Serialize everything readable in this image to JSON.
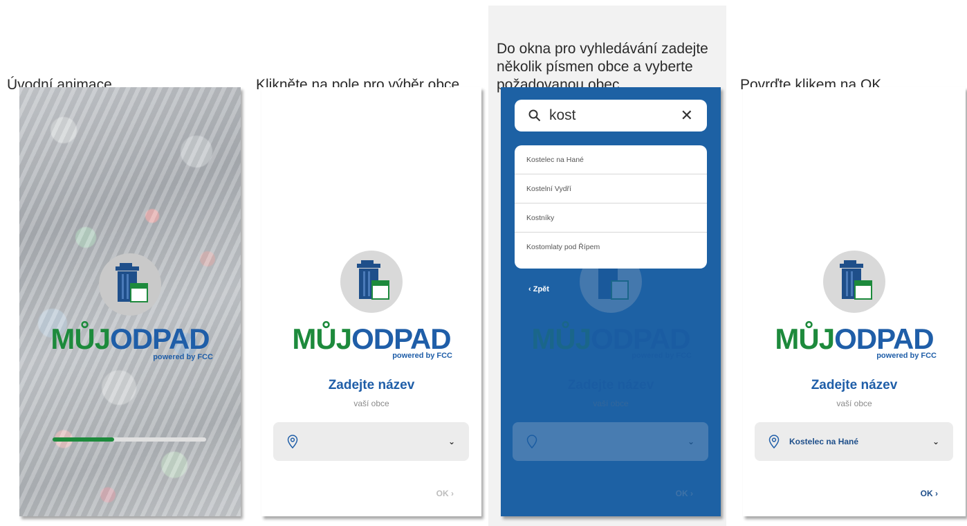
{
  "steps": [
    {
      "caption": "Úvodní animace"
    },
    {
      "caption": "Klikněte na pole pro výběr obce"
    },
    {
      "caption": "Do okna pro vyhledávání zadejte několik písmen obce a vyberte požadovanou obec"
    },
    {
      "caption": "Povrďte klikem na OK"
    }
  ],
  "app": {
    "brand_muj": "MŮJ",
    "brand_odpad": "ODPAD",
    "powered": "powered by FCC",
    "title": "Zadejte název",
    "subtitle": "vaší obce",
    "ok_label": "OK ›",
    "selected_value": "Kostelec na Hané",
    "back_label": "‹ Zpět"
  },
  "splash": {
    "progress": 0.4
  },
  "search": {
    "query": "kost",
    "results": [
      "Kostelec na Hané",
      "Kostelní Vydří",
      "Kostníky",
      "Kostomlaty pod Řípem"
    ]
  },
  "colors": {
    "green": "#1d8a3c",
    "blue": "#1f5ea8",
    "overlay_blue": "#2a72b2"
  }
}
